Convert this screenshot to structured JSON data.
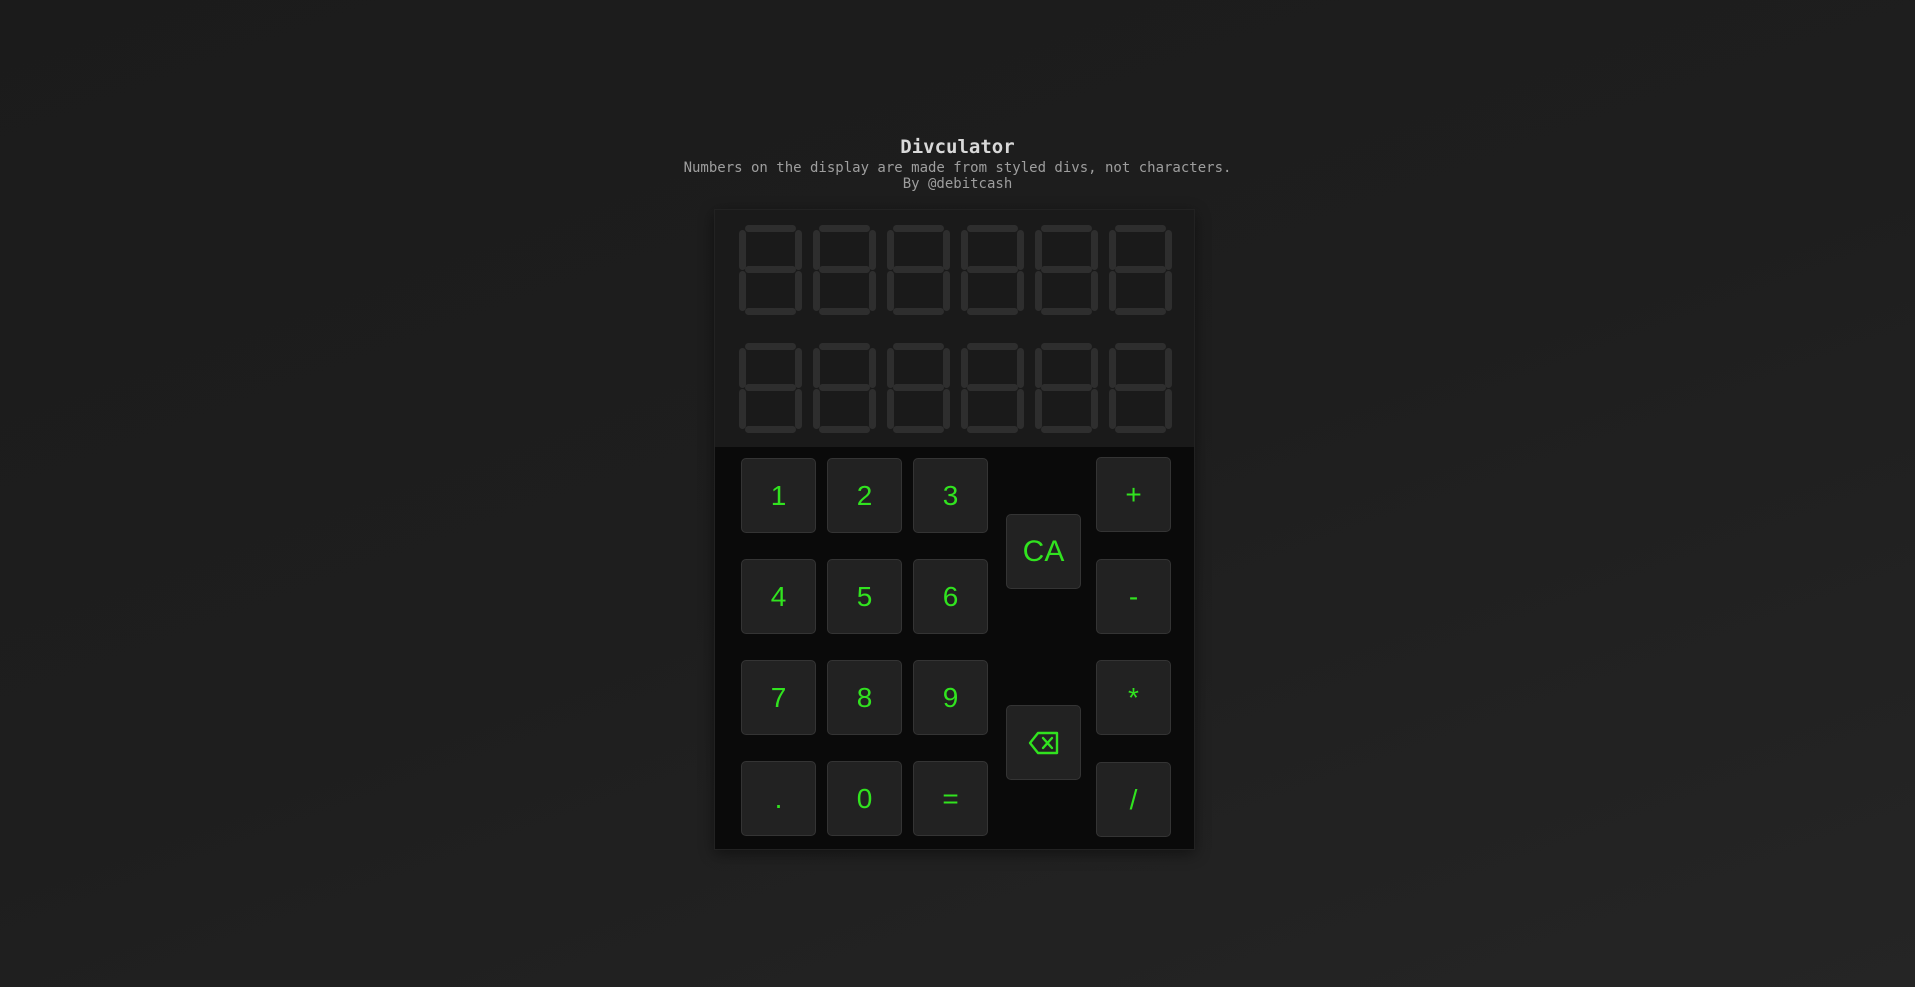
{
  "header": {
    "title": "Divculator",
    "subtitle": "Numbers on the display are made from styled divs, not characters.",
    "byline": "By @debitcash"
  },
  "display": {
    "rows": 2,
    "digits_per_row": 6
  },
  "keypad": {
    "k1": "1",
    "k2": "2",
    "k3": "3",
    "k4": "4",
    "k5": "5",
    "k6": "6",
    "k7": "7",
    "k8": "8",
    "k9": "9",
    "k_dot": ".",
    "k0": "0",
    "k_eq": "=",
    "k_ca": "CA",
    "k_plus": "+",
    "k_minus": "-",
    "k_mul": "*",
    "k_div": "/",
    "backspace_icon": "backspace-icon"
  },
  "colors": {
    "accent": "#31e31f",
    "key_bg": "#222222",
    "display_bg": "#1a1a1a",
    "segment_off": "#2e2e2e"
  }
}
